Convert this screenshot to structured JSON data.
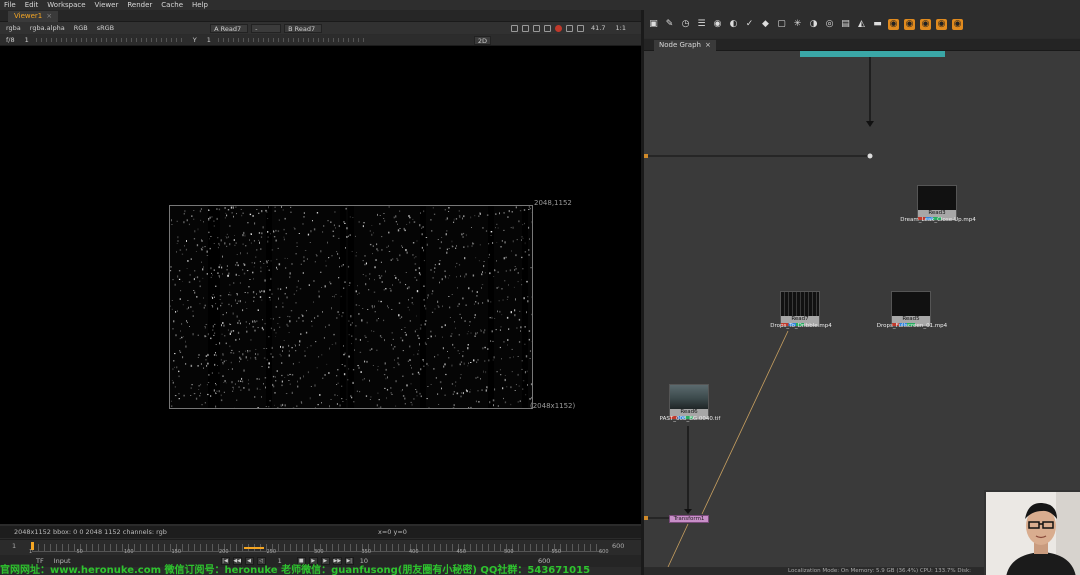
{
  "menu": [
    "File",
    "Edit",
    "Workspace",
    "Viewer",
    "Render",
    "Cache",
    "Help"
  ],
  "viewer": {
    "tab_label": "Viewer1",
    "channels": "rgba",
    "alpha": "rgba.alpha",
    "rgb": "RGB",
    "colorspace": "sRGB",
    "input_a": "A  Read7",
    "dash": "-",
    "input_b": "B  Read7",
    "fstop": "f/8",
    "gain": "1",
    "gamma_label": "Y",
    "gamma": "1",
    "zoom": "41.7",
    "proxy": "1:1",
    "view_mode": "2D",
    "format_tr": "2048,1152",
    "format_br": "(2048x1152)",
    "status_info": "2048x1152  bbox: 0 0 2048 1152 channels: rgb",
    "status_coord": "x=0 y=0"
  },
  "timeline": {
    "start": "1",
    "end": "600",
    "ticks": [
      "1",
      "50",
      "100",
      "150",
      "200",
      "250",
      "300",
      "350",
      "400",
      "450",
      "500",
      "550",
      "600"
    ],
    "current_frame": "1",
    "step": "10",
    "end_field": "600",
    "fps_label": "TF",
    "input_label": "Input"
  },
  "node_graph": {
    "tab_label": "Node Graph",
    "nodes": [
      {
        "label": "Read3",
        "file": "Dream_Leak_Close-Up.mp4"
      },
      {
        "label": "Read7",
        "file": "Drops_To_Dribble.mp4"
      },
      {
        "label": "Read5",
        "file": "Drops_Fullscreen_01.mp4"
      },
      {
        "label": "Read6",
        "file": "PAST_008_BG.0040.tif"
      }
    ],
    "transform_label": "Transform1",
    "status": "Localization Mode: On  Memory: 5.9 GB (36.4%)  CPU: 133.7%  Disk:"
  },
  "watermark": "官网网址：www.heronuke.com  微信订阅号：heronuke  老师微信：guanfusong(朋友圈有小秘密)  QQ社群：543671015"
}
